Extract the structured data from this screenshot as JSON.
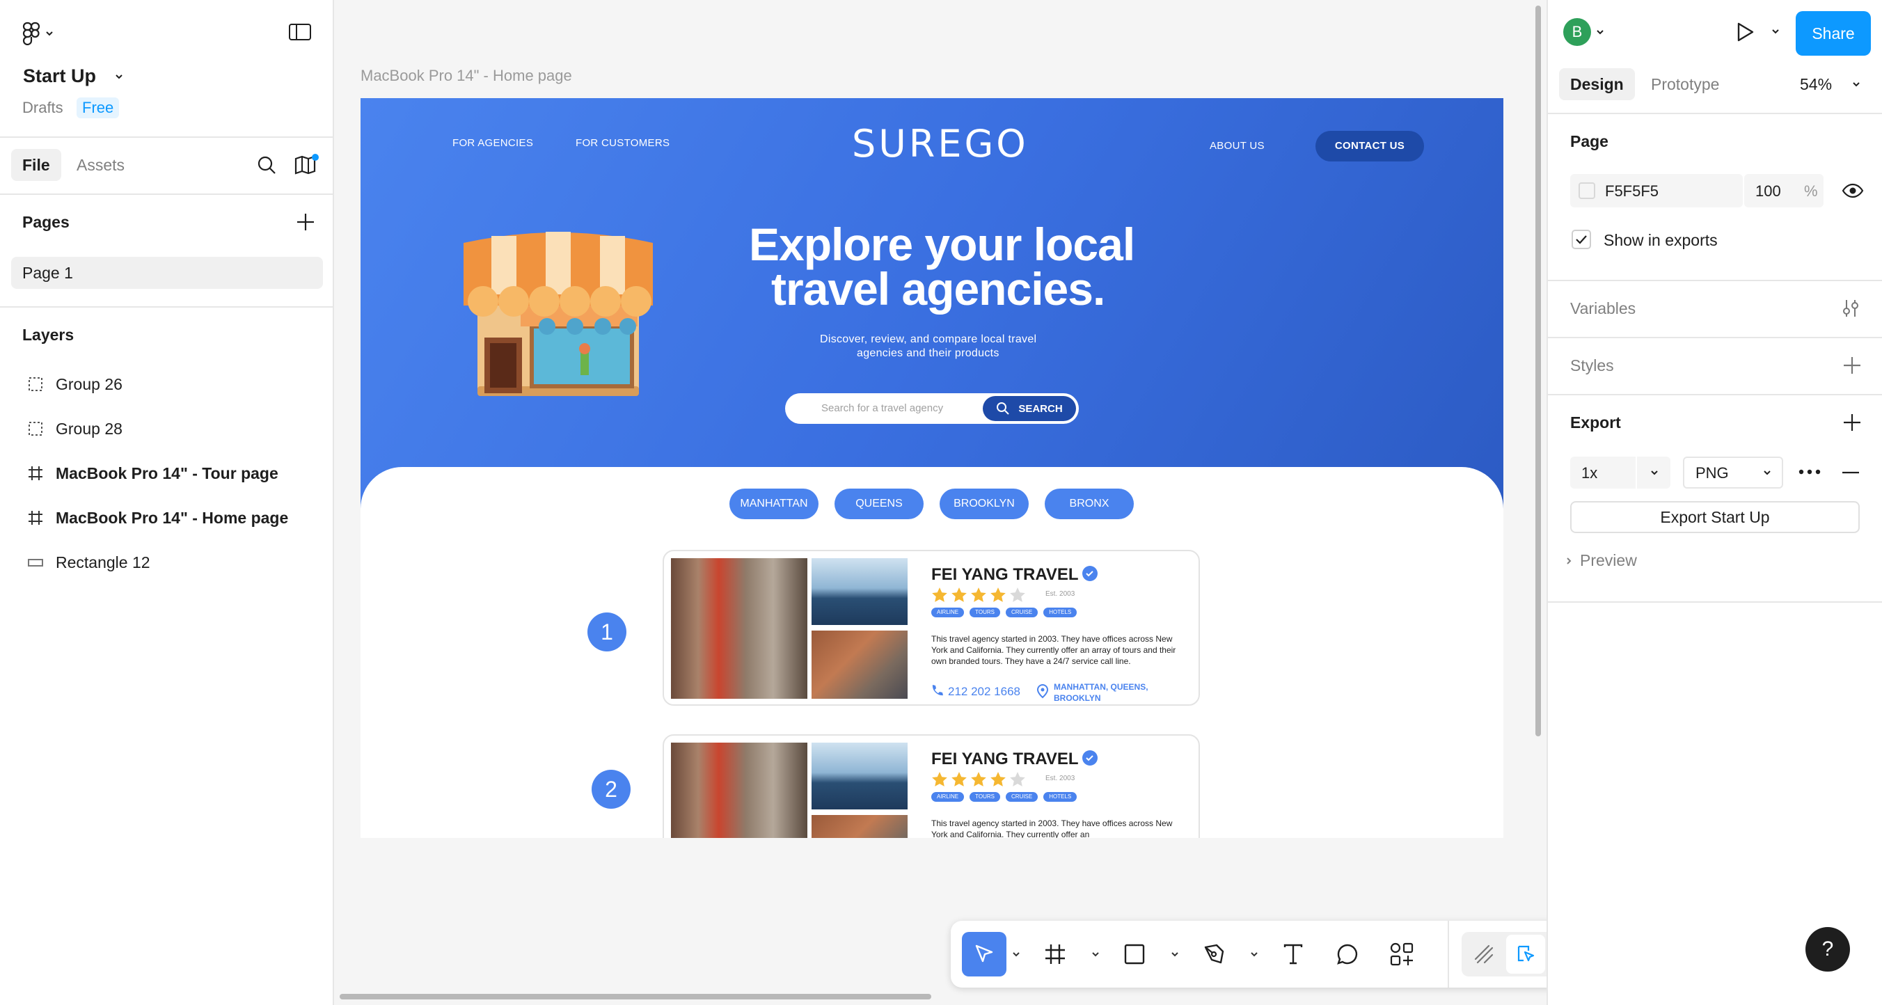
{
  "left_panel": {
    "file_name": "Start Up",
    "location": "Drafts",
    "plan_badge": "Free",
    "tabs": {
      "file": "File",
      "assets": "Assets"
    },
    "pages_heading": "Pages",
    "pages": [
      "Page 1"
    ],
    "layers_heading": "Layers",
    "layers": [
      {
        "name": "Group 26",
        "icon": "group-icon"
      },
      {
        "name": "Group 28",
        "icon": "group-icon"
      },
      {
        "name": "MacBook Pro 14\" - Tour page",
        "icon": "frame-icon"
      },
      {
        "name": "MacBook Pro 14\" - Home page",
        "icon": "frame-icon"
      },
      {
        "name": "Rectangle 12",
        "icon": "rectangle-icon"
      }
    ]
  },
  "right_panel": {
    "avatar_initial": "B",
    "share_label": "Share",
    "tabs": {
      "design": "Design",
      "prototype": "Prototype"
    },
    "zoom": "54%",
    "page_section": "Page",
    "page_color": "F5F5F5",
    "page_opacity": "100",
    "opacity_unit": "%",
    "show_in_exports": "Show in exports",
    "variables": "Variables",
    "styles": "Styles",
    "export": "Export",
    "export_scale": "1x",
    "export_format": "PNG",
    "export_button": "Export Start Up",
    "preview": "Preview",
    "help": "?"
  },
  "canvas": {
    "frame_label": "MacBook Pro 14\" - Home page",
    "site": {
      "nav_left": [
        "FOR AGENCIES",
        "FOR CUSTOMERS"
      ],
      "logo": "SUREGO",
      "nav_about": "ABOUT US",
      "nav_contact": "CONTACT US",
      "headline_1": "Explore your local",
      "headline_2": "travel agencies.",
      "sub_1": "Discover, review, and compare local travel",
      "sub_2": "agencies and their products",
      "search_placeholder": "Search for a travel agency",
      "search_button": "SEARCH",
      "boroughs": [
        "MANHATTAN",
        "QUEENS",
        "BROOKLYN",
        "BRONX"
      ],
      "cards": [
        {
          "rank": "1",
          "name": "FEI YANG TRAVEL",
          "established": "Est. 2003",
          "rating": 4,
          "tags": [
            "AIRLINE",
            "TOURS",
            "CRUISE",
            "HOTELS"
          ],
          "desc": "This travel agency started in 2003. They have offices across New York and California. They currently offer an array of tours and their own branded tours. They have a 24/7 service call line.",
          "phone": "212 202 1668",
          "location_1": "MANHATTAN, QUEENS,",
          "location_2": "BROOKLYN"
        },
        {
          "rank": "2",
          "name": "FEI YANG TRAVEL",
          "established": "Est. 2003",
          "rating": 4,
          "tags": [
            "AIRLINE",
            "TOURS",
            "CRUISE",
            "HOTELS"
          ],
          "desc": "This travel agency started in 2003. They have offices across New York and California. They currently offer an"
        }
      ]
    }
  },
  "colors": {
    "accent": "#0d99ff",
    "hero_blue": "#4a83ee",
    "contact_btn": "#1e4aa8",
    "star": "#f5b731"
  }
}
